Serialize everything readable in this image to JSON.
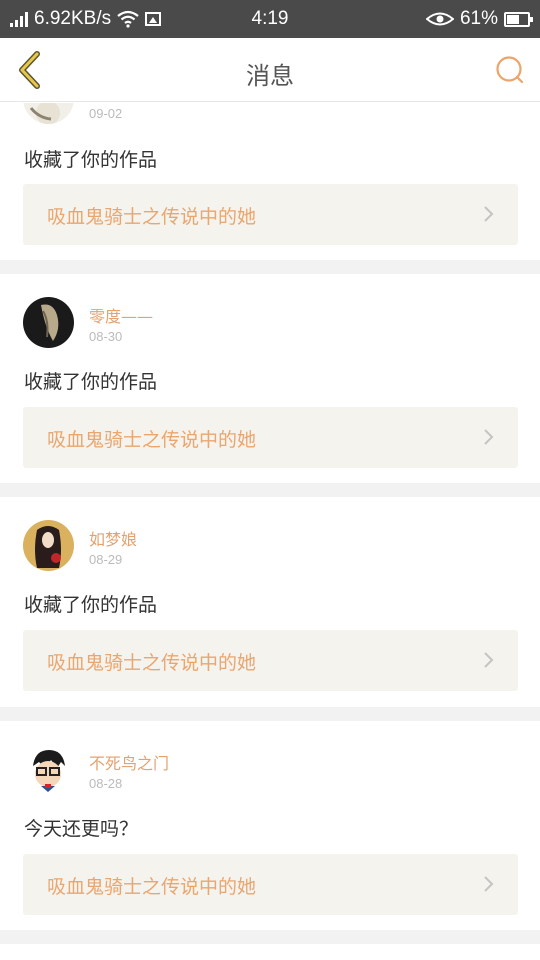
{
  "status_bar": {
    "speed": "6.92KB/s",
    "time": "4:19",
    "battery": "61%",
    "battery_level": 0.61
  },
  "header": {
    "title": "消息",
    "back_icon": "chevron-left-icon",
    "search_icon": "search-icon"
  },
  "colors": {
    "accent": "#e3a26f",
    "work_bg": "#f4f3ee",
    "separator": "#f2f2f2"
  },
  "messages": [
    {
      "user": "",
      "date": "09-02",
      "text": "收藏了你的作品",
      "work": "吸血鬼骑士之传说中的她"
    },
    {
      "user": "零度——",
      "date": "08-30",
      "text": "收藏了你的作品",
      "work": "吸血鬼骑士之传说中的她"
    },
    {
      "user": "如梦娘",
      "date": "08-29",
      "text": "收藏了你的作品",
      "work": "吸血鬼骑士之传说中的她"
    },
    {
      "user": "不死鸟之门",
      "date": "08-28",
      "text": "今天还更吗？",
      "work": "吸血鬼骑士之传说中的她"
    }
  ]
}
